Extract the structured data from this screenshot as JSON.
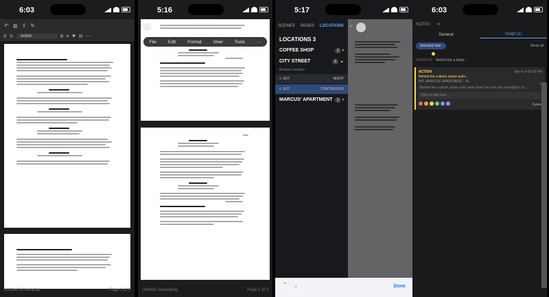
{
  "statusbar": [
    {
      "time": "6:03"
    },
    {
      "time": "5:16"
    },
    {
      "time": "5:17"
    },
    {
      "time": "6:03"
    }
  ],
  "p1": {
    "style_select": "Action",
    "footer_left": "Untitled Screenplay",
    "footer_right": "Page 1 of 3"
  },
  "p2": {
    "menu": [
      "File",
      "Edit",
      "Format",
      "View",
      "Tools",
      "···"
    ],
    "page_header": "BRASS EYE 00",
    "footer_left": "Untitled Screenplay",
    "footer_right": "Page 1 of 3"
  },
  "p3": {
    "tabs": [
      "SCENES",
      "PAGES",
      "LOCATIONS"
    ],
    "close": "✕",
    "heading": "LOCATIONS",
    "heading_count": "3",
    "groups": [
      {
        "name": "COFFEE SHOP",
        "count": "1"
      },
      {
        "name": "CITY STREET",
        "count": "2",
        "sub": "Browse Location"
      },
      {
        "name": "MARCUS' APARTMENT",
        "count": "1"
      }
    ],
    "scene_rows": [
      {
        "num": "2.",
        "label": "EXT",
        "time": "NIGHT"
      },
      {
        "num": "4.",
        "label": "EXT",
        "time": "CONTINUOUS"
      }
    ],
    "done": "Done"
  },
  "p4": {
    "title": "NOTES",
    "tabs": [
      "General",
      "Script (1)"
    ],
    "selected_chip": "Selected note",
    "show_all": "Show all",
    "context_label": "CONTEXT",
    "context_text": "Behind the a black...",
    "note": {
      "tag": "ACTION",
      "date": "Apr 4 at 06:03 PM",
      "title": "Behind the a black sedan pulls...",
      "location": "INT. MARCUS' APARTMENT - N...",
      "quote": "\"Behind the a black sedan pulls away from the curb, the headlights str...\"",
      "reply_placeholder": "Click to add note...",
      "delete": "Delete"
    },
    "colors": [
      "#e26a6a",
      "#f0a04b",
      "#f5d94a",
      "#6dd06d",
      "#5fa8ff",
      "#b57bff"
    ]
  }
}
